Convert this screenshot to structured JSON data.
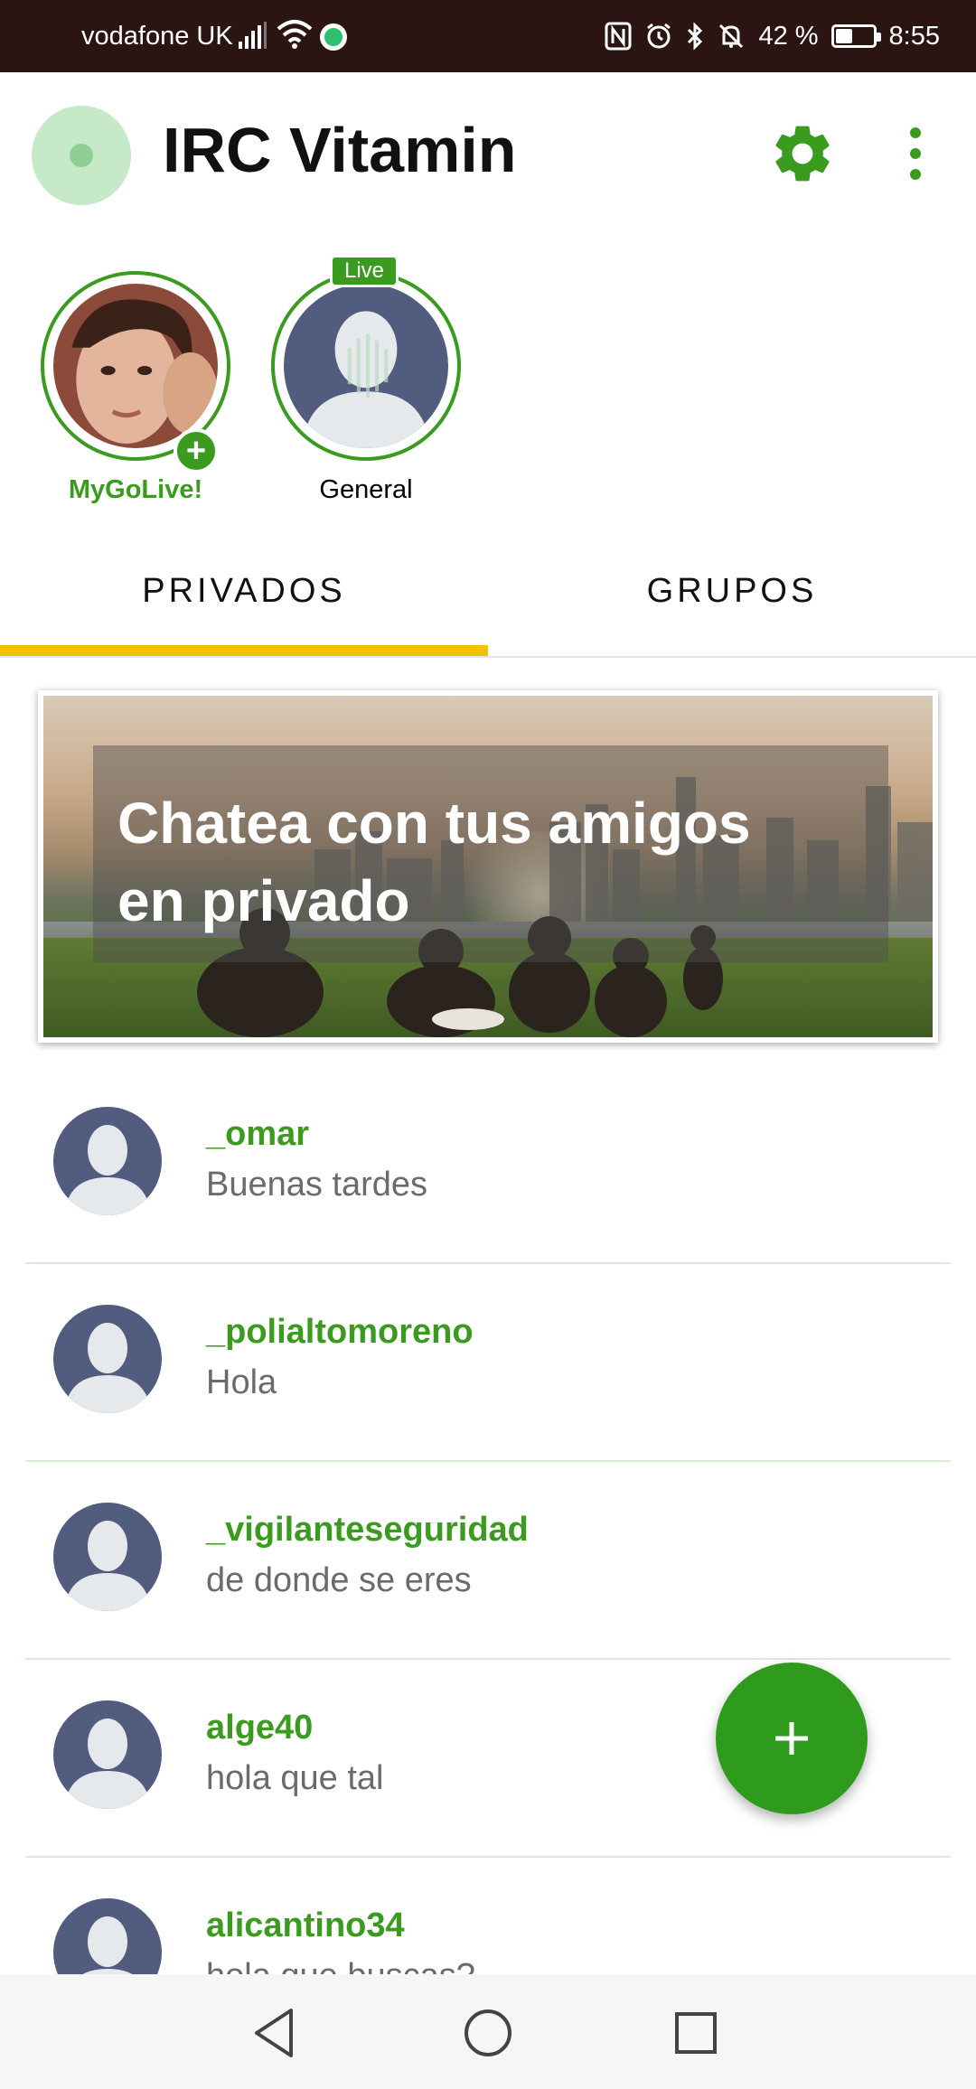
{
  "status_bar": {
    "carrier": "vodafone UK",
    "battery_text": "42 %",
    "battery_level": 0.42,
    "time": "8:55"
  },
  "app_bar": {
    "title": "IRC Vitamin",
    "icons": [
      "app-logo",
      "settings-gear-icon",
      "more-vert-icon"
    ]
  },
  "stories": [
    {
      "label": "MyGoLive!",
      "badge": "+"
    },
    {
      "label": "General",
      "badge": "Live"
    }
  ],
  "tabs": [
    {
      "label": "PRIVADOS",
      "active": true
    },
    {
      "label": "GRUPOS",
      "active": false
    }
  ],
  "banner": {
    "headline_line1": "Chatea con tus amigos",
    "headline_line2": "en privado"
  },
  "chats": [
    {
      "name": "_omar",
      "message": "Buenas tardes"
    },
    {
      "name": "_polialtomoreno",
      "message": "Hola"
    },
    {
      "name": "_vigilanteseguridad",
      "message": "de donde se eres"
    },
    {
      "name": "alge40",
      "message": "hola que tal"
    },
    {
      "name": "alicantino34",
      "message": "hola que buscas?"
    }
  ],
  "fab": {
    "icon": "plus-icon"
  },
  "nav_bar": {
    "icons": [
      "back-icon",
      "home-icon",
      "recents-icon"
    ]
  },
  "colors": {
    "accent_green": "#3a9b1e",
    "tab_indicator": "#f2c200",
    "status_bar_bg": "#2b1512",
    "avatar_placeholder": "#525c7e"
  }
}
